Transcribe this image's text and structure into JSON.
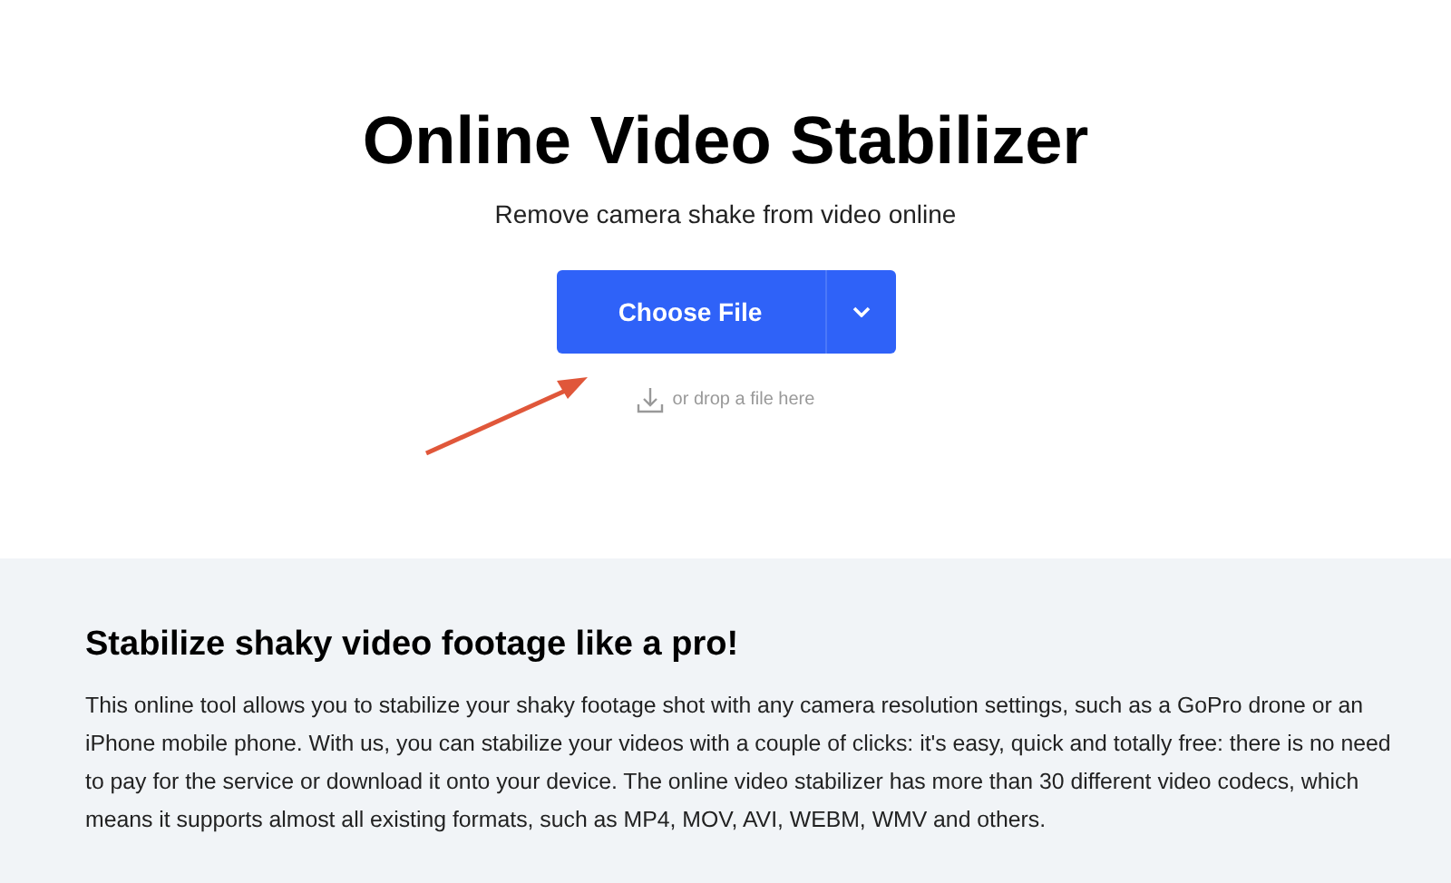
{
  "hero": {
    "title": "Online Video Stabilizer",
    "subtitle": "Remove camera shake from video online",
    "upload_button": {
      "label": "Choose File"
    },
    "drop_hint": "or drop a file here"
  },
  "info": {
    "heading": "Stabilize shaky video footage like a pro!",
    "paragraph": "This online tool allows you to stabilize your shaky footage shot with any camera resolution settings, such as a GoPro drone or an iPhone mobile phone. With us, you can stabilize your videos with a couple of clicks: it's easy, quick and totally free: there is no need to pay for the service or download it onto your device. The online video stabilizer has more than 30 different video codecs, which means it supports almost all existing formats, such as MP4, MOV, AVI, WEBM, WMV and others."
  }
}
